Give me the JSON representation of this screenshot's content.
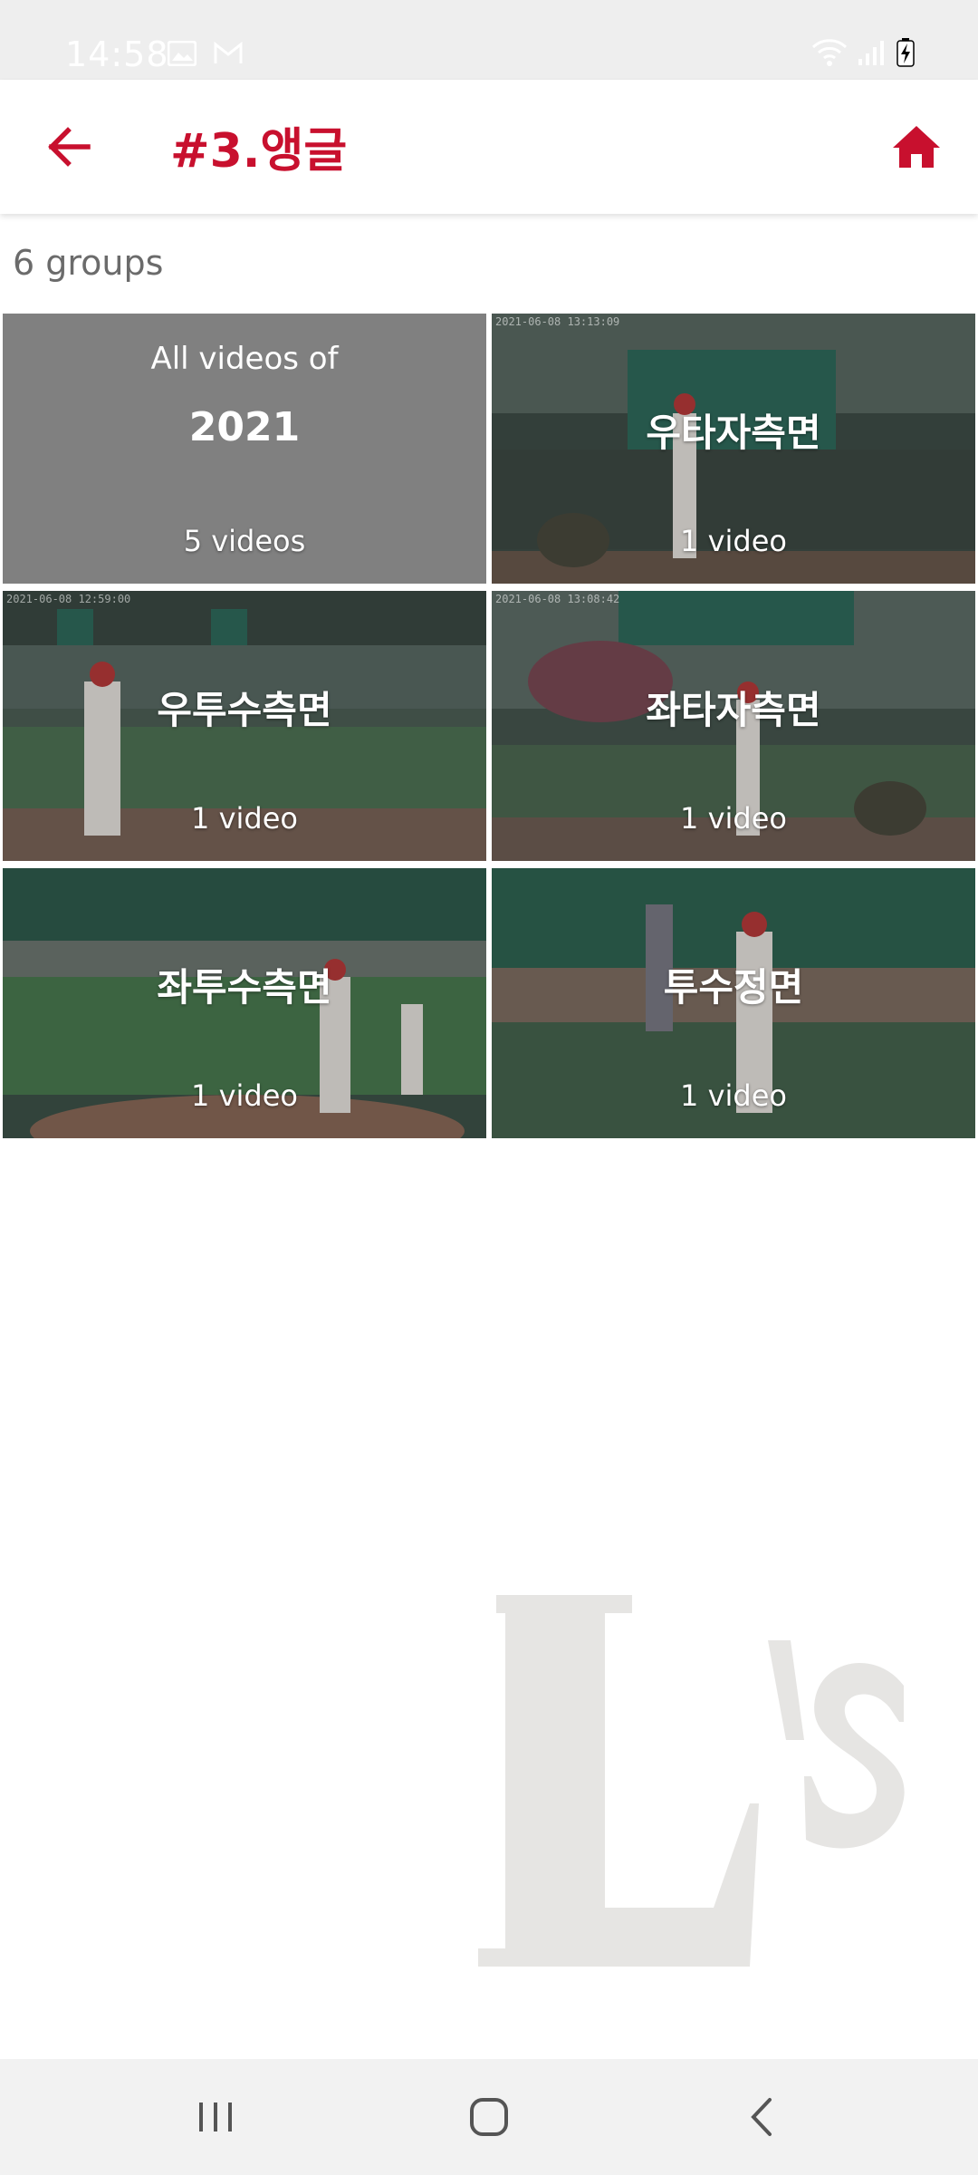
{
  "status_bar": {
    "time": "14:58"
  },
  "app_bar": {
    "title": "#3.앵글",
    "accent_color": "#c8102e"
  },
  "summary": {
    "group_count": "6 groups"
  },
  "all_videos_tile": {
    "label": "All videos of",
    "year": "2021",
    "count": "5 videos"
  },
  "groups": [
    {
      "title": "우타자측면",
      "count": "1 video",
      "stamp": "2021-06-08 13:13:09"
    },
    {
      "title": "우투수측면",
      "count": "1 video",
      "stamp": "2021-06-08 12:59:00"
    },
    {
      "title": "좌타자측면",
      "count": "1 video",
      "stamp": "2021-06-08 13:08:42"
    },
    {
      "title": "좌투수측면",
      "count": "1 video",
      "stamp": ""
    },
    {
      "title": "투수정면",
      "count": "1 video",
      "stamp": ""
    }
  ],
  "icons": {
    "back": "arrow-left-icon",
    "home": "home-icon",
    "nav_recents": "recents-icon",
    "nav_home": "home-circle-icon",
    "nav_back": "chevron-left-icon"
  }
}
